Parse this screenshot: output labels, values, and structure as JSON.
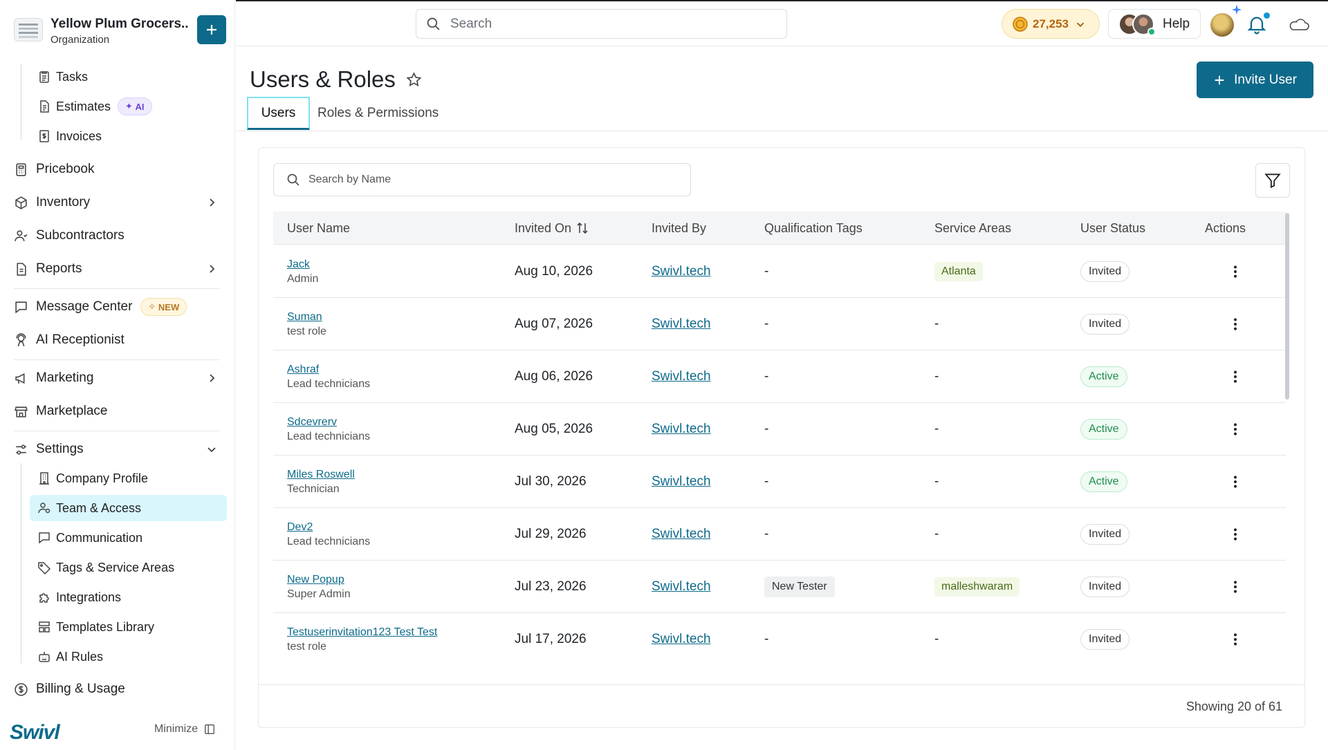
{
  "org": {
    "name": "Yellow Plum Grocers...",
    "subtitle": "Organization"
  },
  "sidebar": {
    "top_items": [
      {
        "label": "Tasks",
        "icon": "clipboard-icon"
      },
      {
        "label": "Estimates",
        "icon": "document-icon",
        "badge": "AI"
      },
      {
        "label": "Invoices",
        "icon": "invoice-icon"
      }
    ],
    "main_items": [
      {
        "label": "Pricebook",
        "icon": "calculator-icon"
      },
      {
        "label": "Inventory",
        "icon": "box-icon"
      },
      {
        "label": "Subcontractors",
        "icon": "users-icon"
      },
      {
        "label": "Reports",
        "icon": "report-icon"
      },
      {
        "label": "Message Center",
        "icon": "chat-icon",
        "badge": "NEW"
      },
      {
        "label": "AI Receptionist",
        "icon": "receptionist-icon"
      },
      {
        "label": "Marketing",
        "icon": "megaphone-icon"
      },
      {
        "label": "Marketplace",
        "icon": "store-icon"
      },
      {
        "label": "Settings",
        "icon": "settings-icon"
      }
    ],
    "settings_items": [
      {
        "label": "Company Profile",
        "icon": "building-icon"
      },
      {
        "label": "Team & Access",
        "icon": "team-icon",
        "active": true
      },
      {
        "label": "Communication",
        "icon": "chat-icon"
      },
      {
        "label": "Tags & Service Areas",
        "icon": "tag-icon"
      },
      {
        "label": "Integrations",
        "icon": "puzzle-icon"
      },
      {
        "label": "Templates Library",
        "icon": "template-icon"
      },
      {
        "label": "AI Rules",
        "icon": "robot-icon"
      }
    ],
    "billing": {
      "label": "Billing & Usage",
      "icon": "dollar-icon"
    },
    "brand": "Swivl",
    "minimize_label": "Minimize"
  },
  "topbar": {
    "search_placeholder": "Search",
    "credits": "27,253",
    "help_label": "Help"
  },
  "page": {
    "title": "Users & Roles",
    "invite_label": "Invite User",
    "tabs": [
      {
        "label": "Users",
        "active": true
      },
      {
        "label": "Roles & Permissions",
        "active": false
      }
    ]
  },
  "table": {
    "search_placeholder": "Search by Name",
    "columns": [
      "User Name",
      "Invited On",
      "Invited By",
      "Qualification Tags",
      "Service Areas",
      "User Status",
      "Actions"
    ],
    "rows": [
      {
        "name": "Jack",
        "role": "Admin",
        "invited_on": "Aug 10, 2026",
        "invited_by": "Swivl.tech",
        "tags": "-",
        "areas": "Atlanta",
        "status": "Invited"
      },
      {
        "name": "Suman",
        "role": "test role",
        "invited_on": "Aug 07, 2026",
        "invited_by": "Swivl.tech",
        "tags": "-",
        "areas": "-",
        "status": "Invited"
      },
      {
        "name": "Ashraf",
        "role": "Lead technicians",
        "invited_on": "Aug 06, 2026",
        "invited_by": "Swivl.tech",
        "tags": "-",
        "areas": "-",
        "status": "Active"
      },
      {
        "name": "Sdcevrerv",
        "role": "Lead technicians",
        "invited_on": "Aug 05, 2026",
        "invited_by": "Swivl.tech",
        "tags": "-",
        "areas": "-",
        "status": "Active"
      },
      {
        "name": "Miles Roswell",
        "role": "Technician",
        "invited_on": "Jul 30, 2026",
        "invited_by": "Swivl.tech",
        "tags": "-",
        "areas": "-",
        "status": "Active"
      },
      {
        "name": "Dev2",
        "role": "Lead technicians",
        "invited_on": "Jul 29, 2026",
        "invited_by": "Swivl.tech",
        "tags": "-",
        "areas": "-",
        "status": "Invited"
      },
      {
        "name": "New Popup",
        "role": "Super Admin",
        "invited_on": "Jul 23, 2026",
        "invited_by": "Swivl.tech",
        "tags": "New Tester",
        "areas": "malleshwaram",
        "status": "Invited"
      },
      {
        "name": "Testuserinvitation123 Test Test",
        "role": "test role",
        "invited_on": "Jul 17, 2026",
        "invited_by": "Swivl.tech",
        "tags": "-",
        "areas": "-",
        "status": "Invited"
      }
    ],
    "footer": "Showing 20 of 61"
  },
  "colors": {
    "accent": "#0e6a8a",
    "active_nav": "#d8f6fc",
    "active_status": "#1f8d4e"
  }
}
